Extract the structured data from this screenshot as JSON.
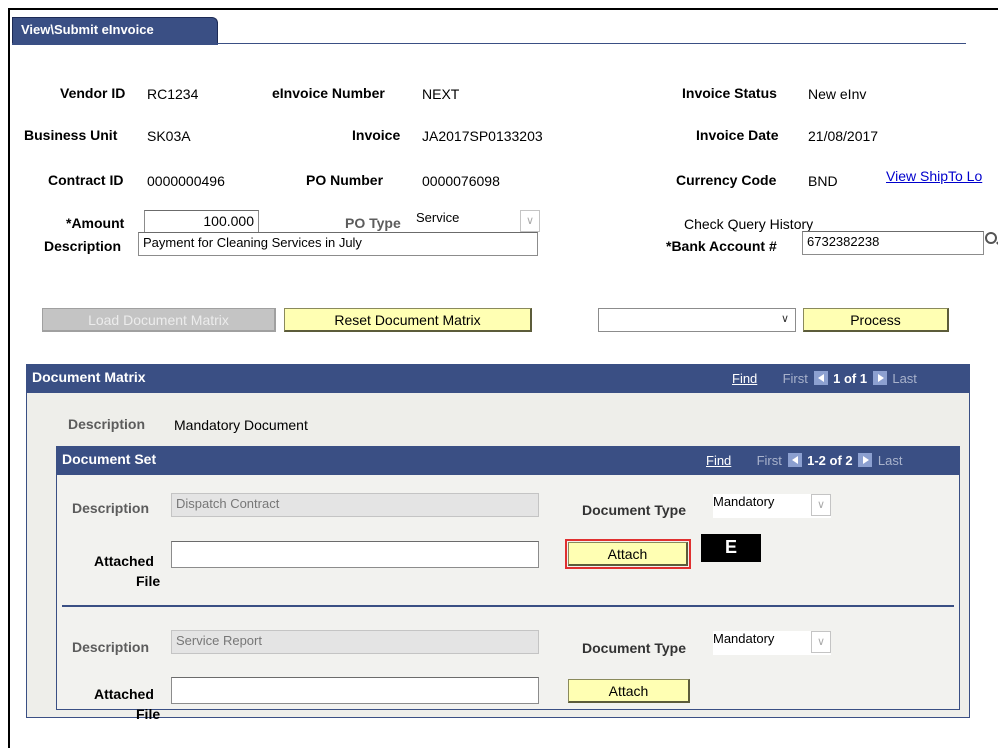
{
  "tab": {
    "label": "View\\Submit eInvoice"
  },
  "header": {
    "vendor_id_label": "Vendor ID",
    "vendor_id": "RC1234",
    "einvoice_number_label": "eInvoice Number",
    "einvoice_number": "NEXT",
    "invoice_status_label": "Invoice Status",
    "invoice_status": "New eInv",
    "business_unit_label": "Business Unit",
    "business_unit": "SK03A",
    "invoice_label": "Invoice",
    "invoice": "JA2017SP0133203",
    "invoice_date_label": "Invoice Date",
    "invoice_date": "21/08/2017",
    "contract_id_label": "Contract ID",
    "contract_id": "0000000496",
    "po_number_label": "PO Number",
    "po_number": "0000076098",
    "currency_code_label": "Currency Code",
    "currency_code": "BND",
    "view_shipto_link": "View ShipTo Lo",
    "amount_label": "*Amount",
    "amount": "100.000",
    "po_type_label": "PO Type",
    "po_type": "Service",
    "check_query_history": "Check Query History",
    "description_label": "Description",
    "description": "Payment for Cleaning Services in July",
    "bank_account_label": "*Bank Account #",
    "bank_account": "6732382238"
  },
  "actions": {
    "load_matrix": "Load Document Matrix",
    "reset_matrix": "Reset Document Matrix",
    "action_select": "",
    "process": "Process"
  },
  "document_matrix": {
    "title": "Document Matrix",
    "find": "Find",
    "first": "First",
    "count": "1 of 1",
    "last": "Last",
    "description_label": "Description",
    "description": "Mandatory Document"
  },
  "document_set": {
    "title": "Document Set",
    "find": "Find",
    "first": "First",
    "count": "1-2 of 2",
    "last": "Last",
    "rows": [
      {
        "description_label": "Description",
        "description": "Dispatch Contract",
        "doc_type_label": "Document Type",
        "doc_type": "Mandatory",
        "attached_label_1": "Attached",
        "attached_label_2": "File",
        "attached_file": "",
        "attach_button": "Attach"
      },
      {
        "description_label": "Description",
        "description": "Service Report",
        "doc_type_label": "Document Type",
        "doc_type": "Mandatory",
        "attached_label_1": "Attached",
        "attached_label_2": "File",
        "attached_file": "",
        "attach_button": "Attach"
      }
    ]
  },
  "annotation": {
    "badge": "E"
  }
}
